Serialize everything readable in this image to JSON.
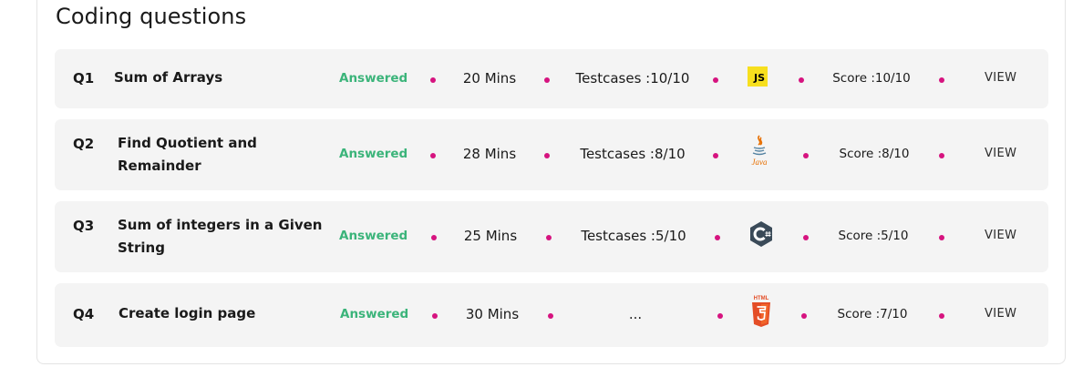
{
  "section": {
    "title": "Coding questions"
  },
  "questions": [
    {
      "num": "Q1",
      "name": "Sum of Arrays",
      "status": "Answered",
      "time": "20 Mins",
      "testcases": "Testcases :10/10",
      "language_icon": "javascript-icon",
      "language_icon_text": "JS",
      "score": "Score :10/10",
      "action": "VIEW"
    },
    {
      "num": "Q2",
      "name": "Find Quotient and Remainder",
      "status": "Answered",
      "time": "28 Mins",
      "testcases": "Testcases :8/10",
      "language_icon": "java-icon",
      "language_icon_text": "Java",
      "score": "Score :8/10",
      "action": "VIEW"
    },
    {
      "num": "Q3",
      "name": "Sum of integers in a Given String",
      "status": "Answered",
      "time": "25 Mins",
      "testcases": "Testcases :5/10",
      "language_icon": "csharp-icon",
      "score": "Score :5/10",
      "action": "VIEW"
    },
    {
      "num": "Q4",
      "name": "Create login page",
      "status": "Answered",
      "time": "30 Mins",
      "testcases": "...",
      "language_icon": "html5-icon",
      "language_icon_text": "HTML",
      "score": "Score :7/10",
      "action": "VIEW"
    }
  ],
  "colors": {
    "status_green": "#3bb47a",
    "separator_magenta": "#d6137f",
    "row_background": "#f4f4f4",
    "js_yellow": "#f7df1e",
    "html5_orange": "#e44d26",
    "csharp_dark": "#3a4a58"
  }
}
